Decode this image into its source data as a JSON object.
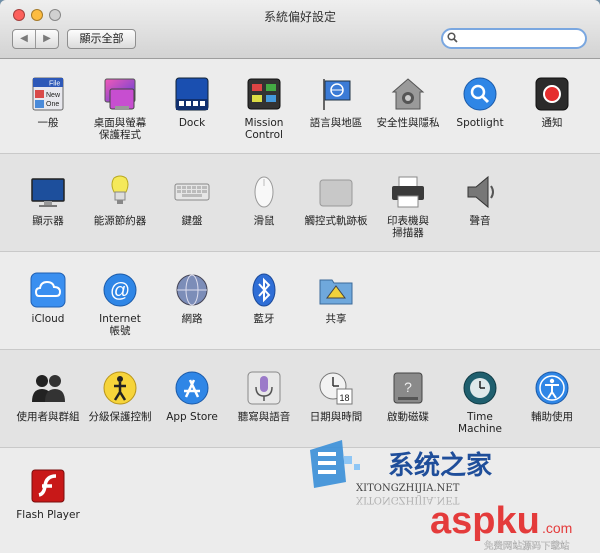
{
  "window": {
    "title": "系統偏好設定",
    "nav_back": "◀",
    "nav_forward": "▶",
    "show_all": "顯示全部",
    "search_placeholder": ""
  },
  "rows": [
    [
      {
        "label": "一般",
        "icon": "general-icon"
      },
      {
        "label": "桌面與螢幕\n保護程式",
        "icon": "desktop-screensaver-icon"
      },
      {
        "label": "Dock",
        "icon": "dock-icon"
      },
      {
        "label": "Mission\nControl",
        "icon": "mission-control-icon"
      },
      {
        "label": "語言與地區",
        "icon": "language-region-icon"
      },
      {
        "label": "安全性與隱私",
        "icon": "security-privacy-icon"
      },
      {
        "label": "Spotlight",
        "icon": "spotlight-icon"
      },
      {
        "label": "通知",
        "icon": "notifications-icon"
      }
    ],
    [
      {
        "label": "顯示器",
        "icon": "displays-icon"
      },
      {
        "label": "能源節約器",
        "icon": "energy-saver-icon"
      },
      {
        "label": "鍵盤",
        "icon": "keyboard-icon"
      },
      {
        "label": "滑鼠",
        "icon": "mouse-icon"
      },
      {
        "label": "觸控式軌跡板",
        "icon": "trackpad-icon"
      },
      {
        "label": "印表機與\n掃描器",
        "icon": "printer-scanner-icon"
      },
      {
        "label": "聲音",
        "icon": "sound-icon"
      }
    ],
    [
      {
        "label": "iCloud",
        "icon": "icloud-icon"
      },
      {
        "label": "Internet\n帳號",
        "icon": "internet-accounts-icon"
      },
      {
        "label": "網路",
        "icon": "network-icon"
      },
      {
        "label": "藍牙",
        "icon": "bluetooth-icon"
      },
      {
        "label": "共享",
        "icon": "sharing-icon"
      }
    ],
    [
      {
        "label": "使用者與群組",
        "icon": "users-groups-icon"
      },
      {
        "label": "分級保護控制",
        "icon": "parental-controls-icon"
      },
      {
        "label": "App Store",
        "icon": "app-store-icon"
      },
      {
        "label": "聽寫與語音",
        "icon": "dictation-speech-icon"
      },
      {
        "label": "日期與時間",
        "icon": "date-time-icon"
      },
      {
        "label": "啟動磁碟",
        "icon": "startup-disk-icon"
      },
      {
        "label": "Time Machine",
        "icon": "time-machine-icon"
      },
      {
        "label": "輔助使用",
        "icon": "accessibility-icon"
      }
    ],
    [
      {
        "label": "Flash Player",
        "icon": "flash-player-icon"
      }
    ]
  ],
  "general_icon_lines": [
    "File",
    "New",
    "One"
  ],
  "date_icon_day": "18",
  "watermark": {
    "brand_cn": "系统之家",
    "brand_en": "XITONGZHIJIA.NET",
    "mirror_en": "XITONGZHIJIA.NET",
    "aspku": "aspku",
    "aspku_com": ".com",
    "aspku_sub": "免费网站源码下载站"
  },
  "colors": {
    "close": "#fc605c",
    "minimize": "#fdbc40",
    "zoom": "#34c84a",
    "accent_blue": "#2f86e6"
  }
}
